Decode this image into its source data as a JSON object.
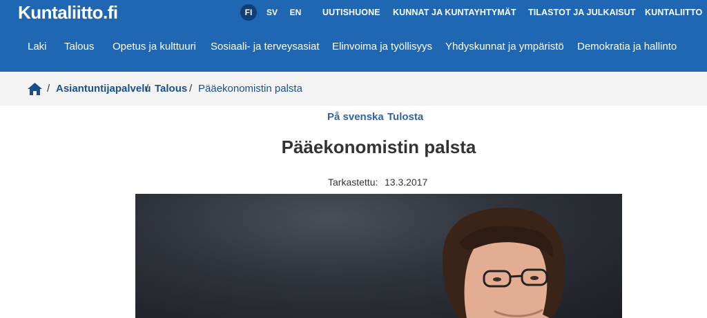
{
  "header": {
    "logo": "Kuntaliitto.fi",
    "languages": [
      "FI",
      "SV",
      "EN"
    ],
    "active_language": "FI",
    "top_links": [
      "UUTISHUONE",
      "KUNNAT JA KUNTAYHTYMÄT",
      "TILASTOT JA JULKAISUT",
      "KUNTALIITTO"
    ],
    "main_nav": [
      "Laki",
      "Talous",
      "Opetus ja kulttuuri",
      "Sosiaali- ja terveysasiat",
      "Elinvoima ja työllisyys",
      "Yhdyskunnat ja ympäristö",
      "Demokratia ja hallinto"
    ]
  },
  "breadcrumb": {
    "home_icon": "home-icon",
    "separator": "/",
    "items": [
      "Asiantuntijapalvelu",
      "Talous",
      "Pääekonomistin palsta"
    ]
  },
  "page_tools": {
    "swedish": "På svenska",
    "print": "Tulosta"
  },
  "page": {
    "title": "Pääekonomistin palsta",
    "reviewed_label": "Tarkastettu:",
    "reviewed_date": "13.3.2017"
  },
  "colors": {
    "header_bg": "#1f66b3",
    "active_lang_bg": "#0e3f7a",
    "breadcrumb_bg": "#f3f3f3",
    "link": "#1a4f8e"
  }
}
